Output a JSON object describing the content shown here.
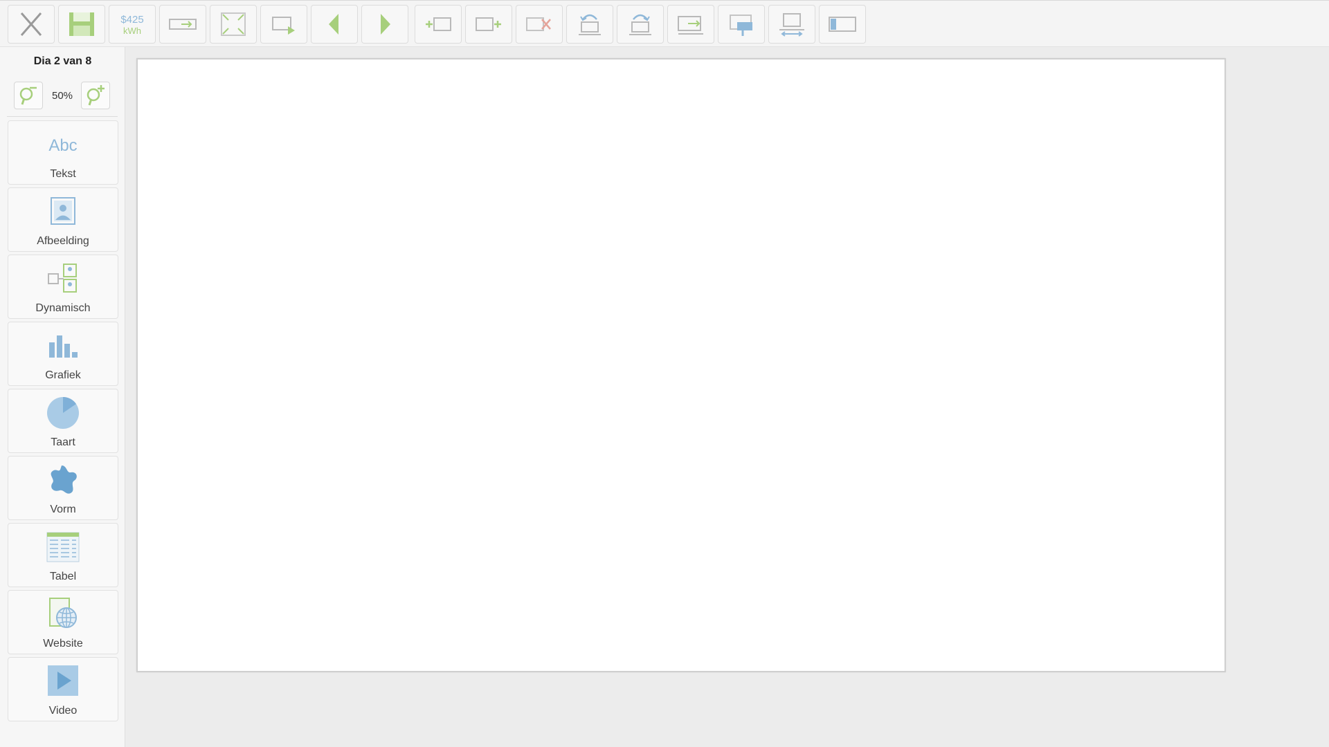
{
  "toolbar": {
    "buttons": [
      {
        "name": "close-icon"
      },
      {
        "name": "save-icon"
      },
      {
        "name": "price-per-kwh-icon",
        "price": "$425",
        "unit": "kWh"
      },
      {
        "name": "slide-transition-icon"
      },
      {
        "name": "fullscreen-icon"
      },
      {
        "name": "slide-exit-icon"
      },
      {
        "name": "previous-slide-icon"
      },
      {
        "name": "next-slide-icon"
      },
      {
        "name": "add-slide-before-icon"
      },
      {
        "name": "add-slide-after-icon"
      },
      {
        "name": "delete-slide-icon"
      },
      {
        "name": "undo-icon"
      },
      {
        "name": "redo-icon"
      },
      {
        "name": "move-slide-icon"
      },
      {
        "name": "comment-icon"
      },
      {
        "name": "slide-width-icon"
      },
      {
        "name": "slide-layout-icon"
      }
    ]
  },
  "sidebar": {
    "slide_counter": "Dia 2 van 8",
    "zoom": {
      "value": "50%",
      "zoom_out_icon": "zoom-out-icon",
      "zoom_in_icon": "zoom-in-icon"
    },
    "tools": [
      {
        "label": "Tekst",
        "icon": "text-icon",
        "icon_text": "Abc"
      },
      {
        "label": "Afbeelding",
        "icon": "image-icon"
      },
      {
        "label": "Dynamisch",
        "icon": "dynamic-icon"
      },
      {
        "label": "Grafiek",
        "icon": "bar-chart-icon"
      },
      {
        "label": "Taart",
        "icon": "pie-chart-icon"
      },
      {
        "label": "Vorm",
        "icon": "shape-icon"
      },
      {
        "label": "Tabel",
        "icon": "table-icon"
      },
      {
        "label": "Website",
        "icon": "website-icon"
      },
      {
        "label": "Video",
        "icon": "video-icon"
      }
    ]
  },
  "colors": {
    "accent_green": "#8cc34a",
    "accent_blue": "#8fb8d9",
    "icon_gray": "#b9b9b9"
  }
}
